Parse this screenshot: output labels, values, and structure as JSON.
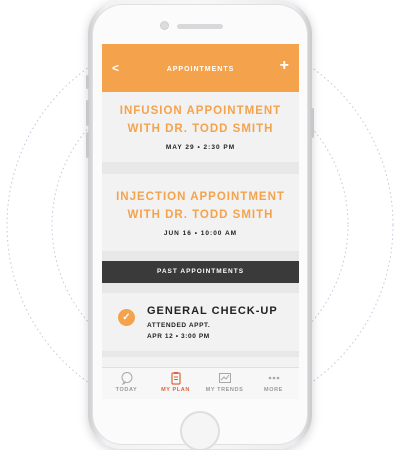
{
  "header": {
    "title": "APPOINTMENTS",
    "back_icon": "chevron-left-icon",
    "add_icon": "plus-icon",
    "accent": "#f4a34c"
  },
  "upcoming": [
    {
      "title_line1": "INFUSION APPOINTMENT",
      "title_line2": "WITH DR. TODD SMITH",
      "datetime": "MAY 29 • 2:30 PM"
    },
    {
      "title_line1": "INJECTION APPOINTMENT",
      "title_line2": "WITH DR. TODD SMITH",
      "datetime": "JUN 16 • 10:00 AM"
    }
  ],
  "past_section_label": "PAST APPOINTMENTS",
  "past": [
    {
      "title": "GENERAL CHECK-UP",
      "status": "ATTENDED APPT.",
      "datetime": "APR 12 • 3:00 PM",
      "icon": "checkmark-icon"
    }
  ],
  "tabs": [
    {
      "label": "TODAY",
      "icon": "chat-icon",
      "active": false
    },
    {
      "label": "MY PLAN",
      "icon": "clipboard-icon",
      "active": true
    },
    {
      "label": "MY TRENDS",
      "icon": "chart-icon",
      "active": false
    },
    {
      "label": "MORE",
      "icon": "more-dots-icon",
      "active": false
    }
  ],
  "colors": {
    "active_tab": "#e0643a",
    "dark_bar": "#3a3a3a"
  }
}
